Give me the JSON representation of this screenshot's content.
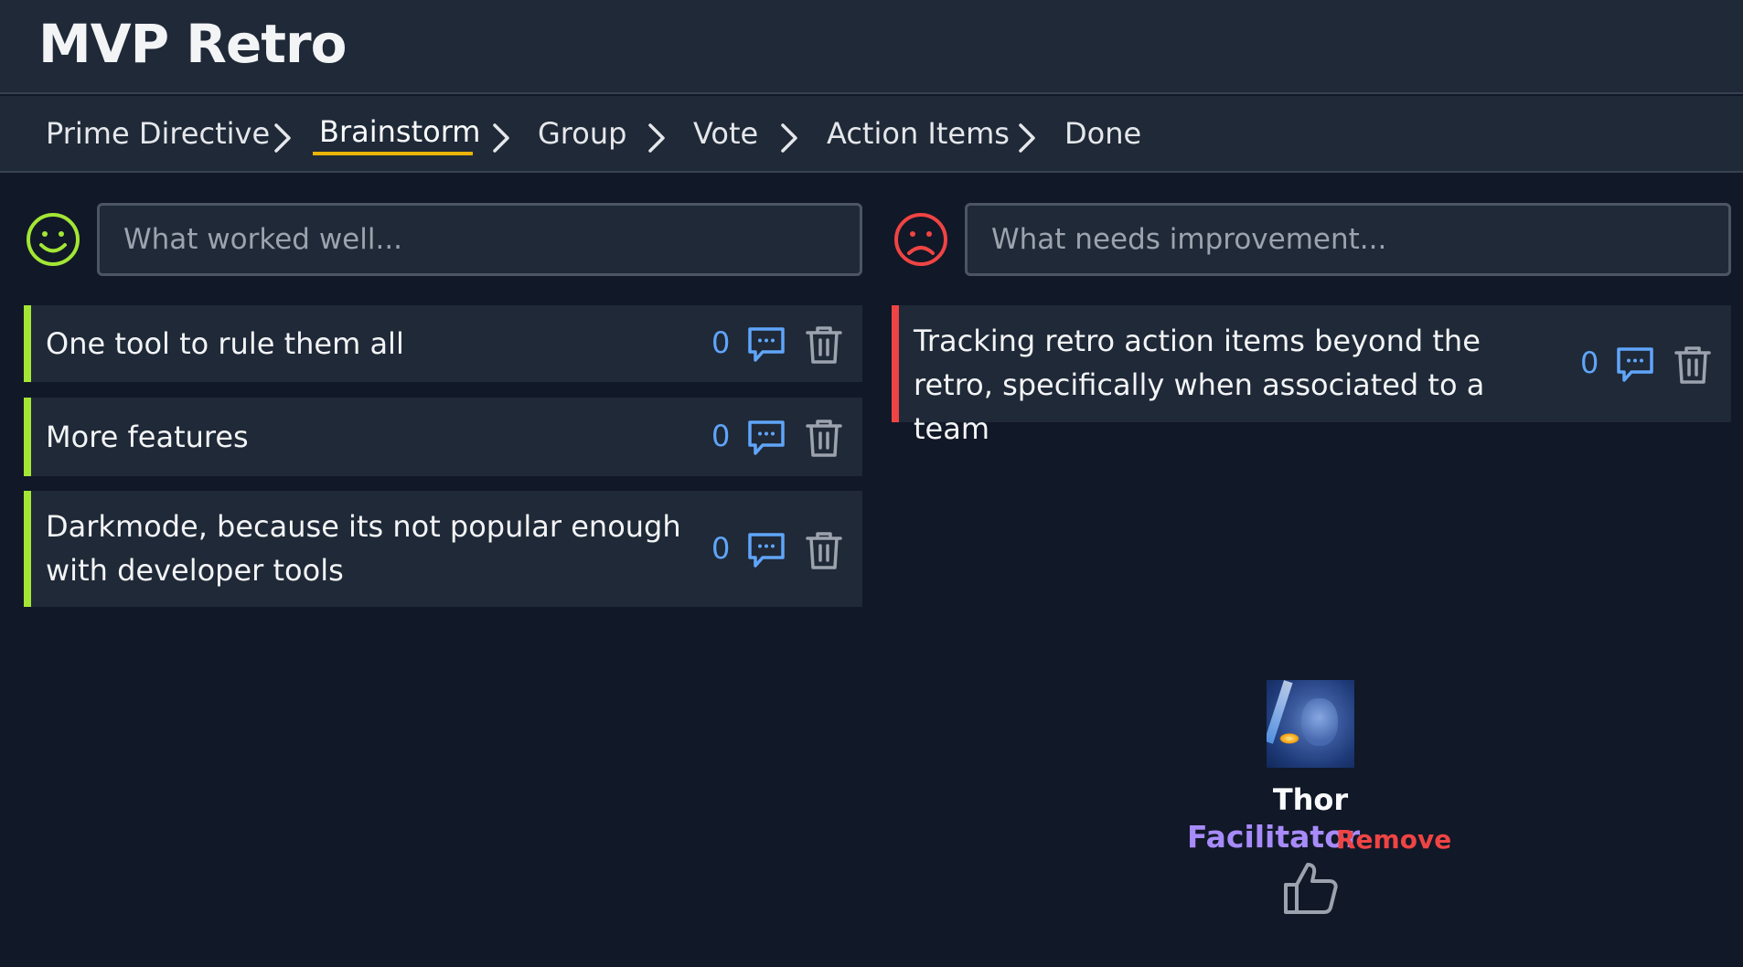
{
  "app": {
    "title": "MVP Retro"
  },
  "stepper": {
    "steps": [
      {
        "label": "Prime Directive"
      },
      {
        "label": "Brainstorm",
        "active": true
      },
      {
        "label": "Group"
      },
      {
        "label": "Vote"
      },
      {
        "label": "Action Items"
      },
      {
        "label": "Done"
      }
    ]
  },
  "columns": {
    "good": {
      "icon": "smiley-face-icon",
      "placeholder": "What worked well...",
      "accent": "#a3e635",
      "items": [
        {
          "text": "One tool to rule them all",
          "comment_count": "0"
        },
        {
          "text": "More features",
          "comment_count": "0"
        },
        {
          "text": "Darkmode, because its not popular enough with developer tools",
          "comment_count": "0"
        }
      ]
    },
    "improve": {
      "icon": "sad-face-icon",
      "placeholder": "What needs improvement...",
      "accent": "#ef4444",
      "items": [
        {
          "text": "Tracking retro action items beyond the retro, specifically when associated to a team",
          "comment_count": "0"
        }
      ]
    }
  },
  "participant": {
    "name": "Thor",
    "role": "Facilitator",
    "remove_label": "Remove",
    "icon": "thumbs-up-icon"
  },
  "colors": {
    "background": "#111827",
    "panel": "#1f2937",
    "active_step_underline": "#eab308",
    "comment_accent": "#60a5fa",
    "role_color": "#a78bfa"
  }
}
